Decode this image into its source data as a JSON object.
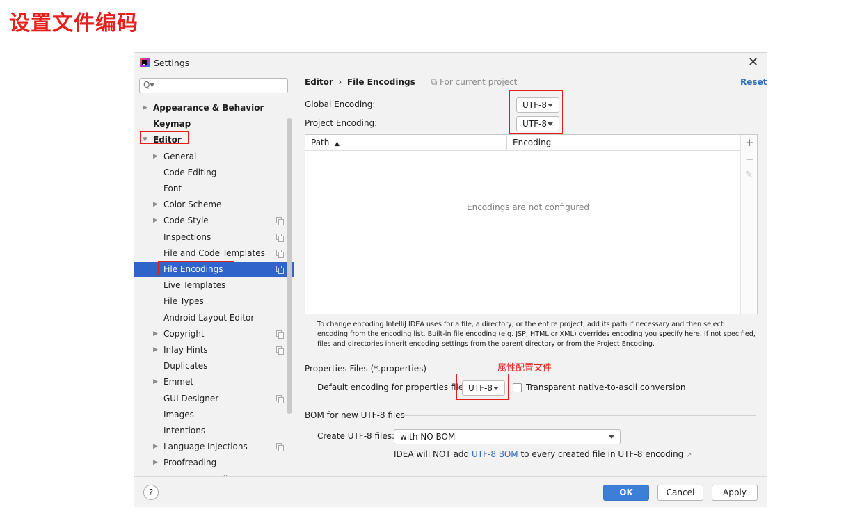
{
  "page_heading": "设置文件编码",
  "window": {
    "title": "Settings",
    "close_icon": "close-icon"
  },
  "search": {
    "placeholder": "Q▾"
  },
  "sidebar": {
    "items": [
      {
        "label": "Appearance & Behavior",
        "level": 0,
        "expandable": true,
        "bold": true
      },
      {
        "label": "Keymap",
        "level": 0,
        "expandable": false,
        "bold": true
      },
      {
        "label": "Editor",
        "level": 0,
        "expandable": true,
        "expanded": true,
        "bold": true
      },
      {
        "label": "General",
        "level": 1,
        "expandable": true
      },
      {
        "label": "Code Editing",
        "level": 1
      },
      {
        "label": "Font",
        "level": 1
      },
      {
        "label": "Color Scheme",
        "level": 1,
        "expandable": true
      },
      {
        "label": "Code Style",
        "level": 1,
        "expandable": true,
        "project_icon": true
      },
      {
        "label": "Inspections",
        "level": 1,
        "project_icon": true
      },
      {
        "label": "File and Code Templates",
        "level": 1,
        "project_icon": true
      },
      {
        "label": "File Encodings",
        "level": 1,
        "selected": true,
        "project_icon": true
      },
      {
        "label": "Live Templates",
        "level": 1
      },
      {
        "label": "File Types",
        "level": 1
      },
      {
        "label": "Android Layout Editor",
        "level": 1
      },
      {
        "label": "Copyright",
        "level": 1,
        "expandable": true,
        "project_icon": true
      },
      {
        "label": "Inlay Hints",
        "level": 1,
        "expandable": true,
        "project_icon": true
      },
      {
        "label": "Duplicates",
        "level": 1
      },
      {
        "label": "Emmet",
        "level": 1,
        "expandable": true
      },
      {
        "label": "GUI Designer",
        "level": 1,
        "project_icon": true
      },
      {
        "label": "Images",
        "level": 1
      },
      {
        "label": "Intentions",
        "level": 1
      },
      {
        "label": "Language Injections",
        "level": 1,
        "expandable": true,
        "project_icon": true
      },
      {
        "label": "Proofreading",
        "level": 1,
        "expandable": true
      },
      {
        "label": "TextMate Bundles",
        "level": 1
      }
    ]
  },
  "breadcrumb": {
    "parent": "Editor",
    "separator": "›",
    "current": "File Encodings",
    "scope": "For current project"
  },
  "reset_label": "Reset",
  "global_encoding": {
    "label": "Global Encoding:",
    "value": "UTF-8"
  },
  "project_encoding": {
    "label": "Project Encoding:",
    "value": "UTF-8"
  },
  "table": {
    "columns": [
      "Path",
      "Encoding"
    ],
    "sort_indicator": "▲",
    "empty_text": "Encodings are not configured",
    "tools": {
      "add": "+",
      "remove": "−",
      "edit": "✎"
    }
  },
  "hint_text": "To change encoding IntelliJ IDEA uses for a file, a directory, or the entire project, add its path if necessary and then select encoding from the encoding list. Built-in file encoding (e.g. JSP, HTML or XML) overrides encoding you specify here. If not specified, files and directories inherit encoding settings from the parent directory or from the Project Encoding.",
  "properties_section": {
    "title": "Properties Files (*.properties)",
    "annotation": "属性配置文件",
    "default_label": "Default encoding for properties files:",
    "default_value": "UTF-8",
    "checkbox_label": "Transparent native-to-ascii conversion",
    "checkbox_checked": false
  },
  "bom_section": {
    "title": "BOM for new UTF-8 files",
    "create_label": "Create UTF-8 files:",
    "create_value": "with NO BOM",
    "note_prefix": "IDEA will NOT add",
    "note_link": "UTF-8 BOM",
    "note_suffix": "to every created file in UTF-8 encoding",
    "note_icon": "↗"
  },
  "footer": {
    "help": "?",
    "ok": "OK",
    "cancel": "Cancel",
    "apply": "Apply"
  },
  "colors": {
    "accent": "#2f65ca",
    "annotation_red": "#e0201b",
    "link": "#2f6fb8",
    "heading_red": "#e8201d"
  }
}
